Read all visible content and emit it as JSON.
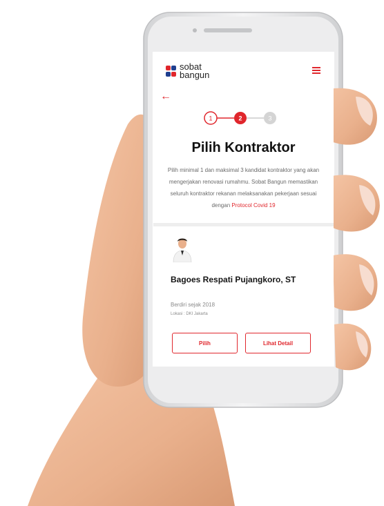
{
  "brand": {
    "line1": "sobat",
    "line2": "bangun"
  },
  "nav": {
    "menu_icon": "hamburger-icon",
    "back_icon": "arrow-left-icon",
    "back_glyph": "←"
  },
  "stepper": {
    "steps": [
      "1",
      "2",
      "3"
    ],
    "current": 2
  },
  "page": {
    "title": "Pilih Kontraktor",
    "description": "Pilih minimal 1 dan maksimal 3 kandidat kontraktor yang akan mengerjakan renovasi rumahmu. Sobat Bangun memastikan seluruh kontraktor rekanan melaksanakan pekerjaan sesuai dengan",
    "protocol_link": "Protocol Covid 19"
  },
  "contractor": {
    "name": "Bagoes Respati Pujangkoro, ST",
    "since": "Berdiri sejak 2018",
    "location": "Lokasi : DKI Jakarta",
    "select_label": "Pilih",
    "detail_label": "Lihat Detail"
  },
  "colors": {
    "accent": "#e0262c",
    "brand_blue": "#1f3f8f",
    "text": "#111111",
    "muted": "#6a6a6a"
  }
}
